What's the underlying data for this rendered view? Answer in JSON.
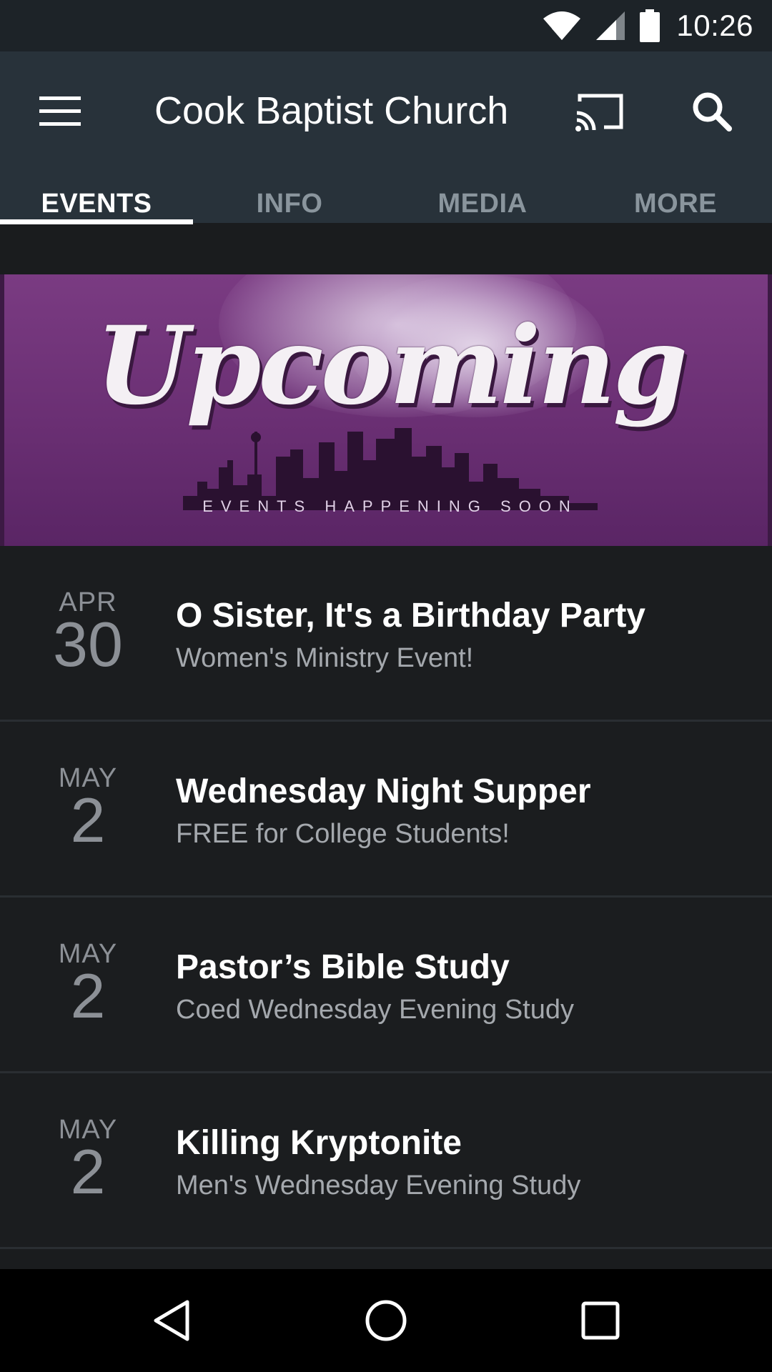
{
  "status_bar": {
    "time": "10:26",
    "icons": [
      "wifi-icon",
      "signal-icon",
      "battery-icon"
    ]
  },
  "app_bar": {
    "title": "Cook Baptist Church",
    "actions": [
      "menu-icon",
      "cast-icon",
      "search-icon"
    ]
  },
  "tabs": [
    {
      "label": "EVENTS",
      "active": true
    },
    {
      "label": "INFO",
      "active": false
    },
    {
      "label": "MEDIA",
      "active": false
    },
    {
      "label": "MORE",
      "active": false
    }
  ],
  "banner": {
    "script_text": "Upcoming",
    "subtitle": "EVENTS HAPPENING SOON"
  },
  "events": [
    {
      "month": "APR",
      "day": "30",
      "title": "O Sister, It's a Birthday Party",
      "subtitle": "Women's Ministry Event!"
    },
    {
      "month": "MAY",
      "day": "2",
      "title": "Wednesday Night Supper",
      "subtitle": "FREE for College Students!"
    },
    {
      "month": "MAY",
      "day": "2",
      "title": "Pastor’s Bible Study",
      "subtitle": "Coed Wednesday Evening Study"
    },
    {
      "month": "MAY",
      "day": "2",
      "title": "Killing Kryptonite",
      "subtitle": "Men's Wednesday Evening Study"
    }
  ],
  "nav_bar": {
    "buttons": [
      "back-icon",
      "home-icon",
      "recents-icon"
    ]
  },
  "colors": {
    "app_bar": "#28323a",
    "status_bar": "#1d2328",
    "list_bg": "#1b1d1f",
    "banner_purple": "#7a3b82",
    "tab_inactive": "#8a959d"
  }
}
